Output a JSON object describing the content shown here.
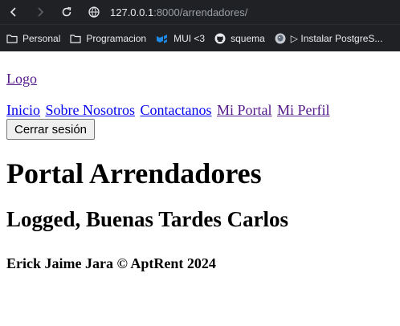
{
  "browser": {
    "address_host": "127.0.0.1",
    "address_path": ":8000/arrendadores/",
    "bookmarks": [
      {
        "label": "Personal",
        "icon": "folder-icon"
      },
      {
        "label": "Programacion",
        "icon": "folder-icon"
      },
      {
        "label": "MUI <3",
        "icon": "mui-icon"
      },
      {
        "label": "squema",
        "icon": "github-icon"
      },
      {
        "label": "▷ Instalar PostgreS...",
        "icon": "postgres-icon"
      }
    ]
  },
  "page": {
    "logo": "Logo",
    "nav": [
      {
        "label": "Inicio"
      },
      {
        "label": "Sobre Nosotros"
      },
      {
        "label": "Contactanos"
      },
      {
        "label": "Mi Portal"
      },
      {
        "label": "Mi Perfil"
      }
    ],
    "logout_label": "Cerrar sesión",
    "title": "Portal Arrendadores",
    "greeting": "Logged, Buenas Tardes Carlos",
    "footer": "Erick Jaime Jara © AptRent 2024"
  },
  "colors": {
    "link": "#0000ee",
    "visited_link": "#551a8b",
    "chrome_bg": "#202124"
  }
}
